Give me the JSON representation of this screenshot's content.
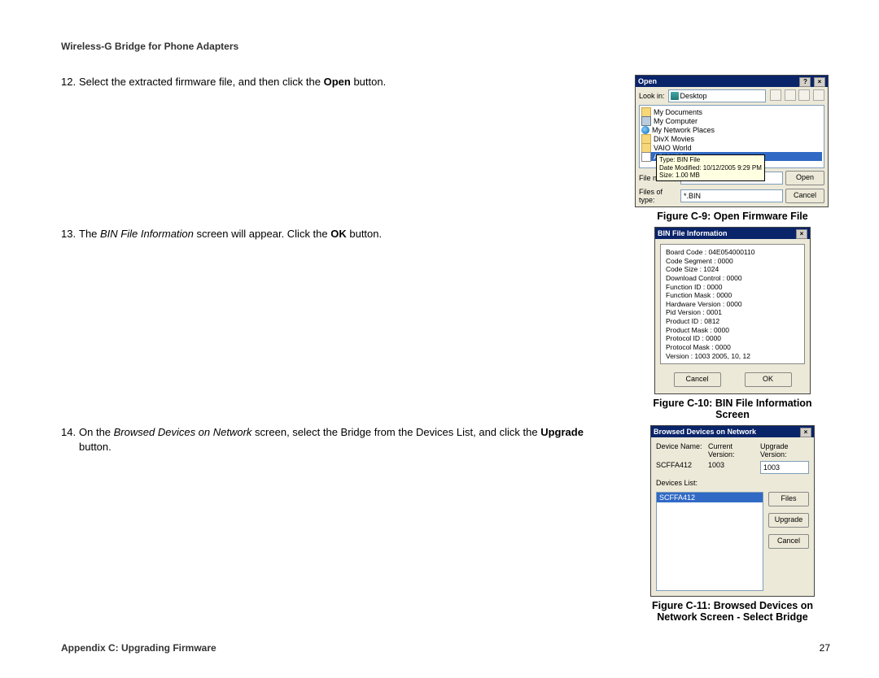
{
  "header": "Wireless-G Bridge for Phone Adapters",
  "steps": {
    "s12": {
      "num": "12.",
      "t1": "Select the extracted firmware file, and then click the ",
      "b1": "Open",
      "t2": " button."
    },
    "s13": {
      "num": "13.",
      "t1": "The ",
      "i1": "BIN File Information",
      "t2": " screen will appear. Click the ",
      "b1": "OK",
      "t3": " button."
    },
    "s14": {
      "num": "14.",
      "t1": "On the ",
      "i1": "Browsed Devices on Network",
      "t2": " screen, select the Bridge from the Devices List, and click the ",
      "b1": "Upgrade",
      "t3": " button."
    }
  },
  "fig9": {
    "title": "Open",
    "lookin_label": "Look in:",
    "lookin_value": "Desktop",
    "items": [
      "My Documents",
      "My Computer",
      "My Network Places",
      "DivX Movies",
      "VAIO World",
      "APUW09"
    ],
    "tooltip": {
      "l1": "Type: BIN File",
      "l2": "Date Modified: 10/12/2005 9:29 PM",
      "l3": "Size: 1.00 MB"
    },
    "filename_label": "File name:",
    "filetype_label": "Files of type:",
    "filetype_value": "*.BIN",
    "open_btn": "Open",
    "cancel_btn": "Cancel",
    "caption": "Figure C-9: Open Firmware File"
  },
  "fig10": {
    "title": "BIN File Information",
    "lines": [
      "Board Code : 04E054000110",
      "Code Segment : 0000",
      "Code Size : 1024",
      "Download Control : 0000",
      "Function ID : 0000",
      "Function Mask : 0000",
      "Hardware Version : 0000",
      "Pid Version : 0001",
      "Product ID : 0812",
      "Product Mask : 0000",
      "Protocol ID : 0000",
      "Protocol Mask : 0000",
      "Version : 1003  2005, 10, 12"
    ],
    "cancel_btn": "Cancel",
    "ok_btn": "OK",
    "caption_l1": "Figure C-10: BIN File Information",
    "caption_l2": "Screen"
  },
  "fig11": {
    "title": "Browsed Devices on Network",
    "h_device": "Device Name:",
    "h_current": "Current Version:",
    "h_upgrade": "Upgrade Version:",
    "device_name": "SCFFA412",
    "current_version": "1003",
    "upgrade_version": "1003",
    "list_label": "Devices List:",
    "list_item": "SCFFA412",
    "files_btn": "Files",
    "upgrade_btn": "Upgrade",
    "cancel_btn": "Cancel",
    "caption_l1": "Figure C-11: Browsed Devices on",
    "caption_l2": "Network Screen - Select Bridge"
  },
  "footer": {
    "appendix": "Appendix C: Upgrading Firmware",
    "page": "27"
  }
}
